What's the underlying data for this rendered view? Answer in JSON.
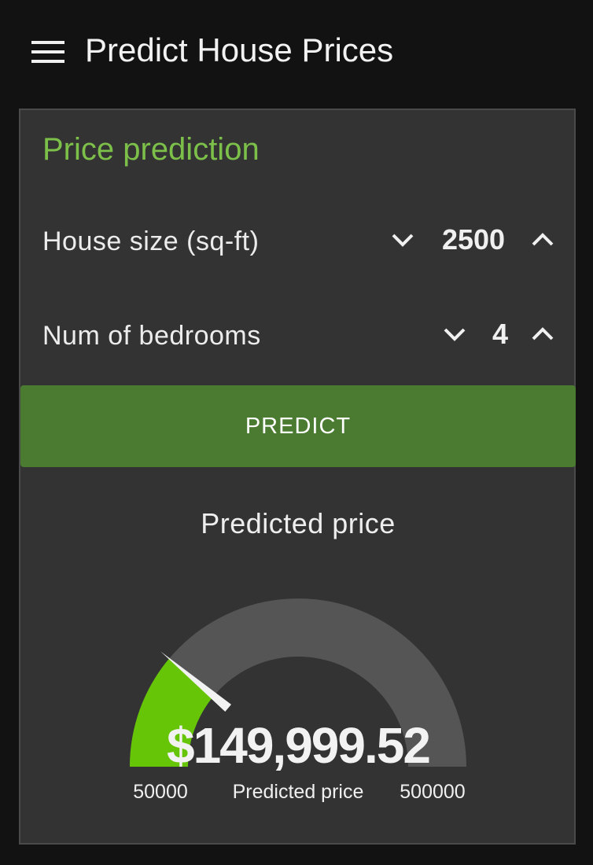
{
  "app_bar": {
    "title": "Predict House Prices",
    "menu_icon": "hamburger-menu-icon"
  },
  "card": {
    "title": "Price prediction",
    "fields": [
      {
        "label": "House size (sq-ft)",
        "value": "2500"
      },
      {
        "label": "Num of bedrooms",
        "value": "4"
      }
    ],
    "predict_label": "PREDICT",
    "result_title": "Predicted price"
  },
  "gauge": {
    "value": 149999.52,
    "value_text": "$149,999.52",
    "min": 50000,
    "max": 500000,
    "min_label": "50000",
    "max_label": "500000",
    "caption": "Predicted price"
  },
  "colors": {
    "background": "#121212",
    "card": "#333333",
    "accent_title": "#7cc04a",
    "button": "#4a7b31",
    "gauge_fill": "#66c507",
    "gauge_track": "#555555",
    "needle": "#f2f2f2"
  }
}
